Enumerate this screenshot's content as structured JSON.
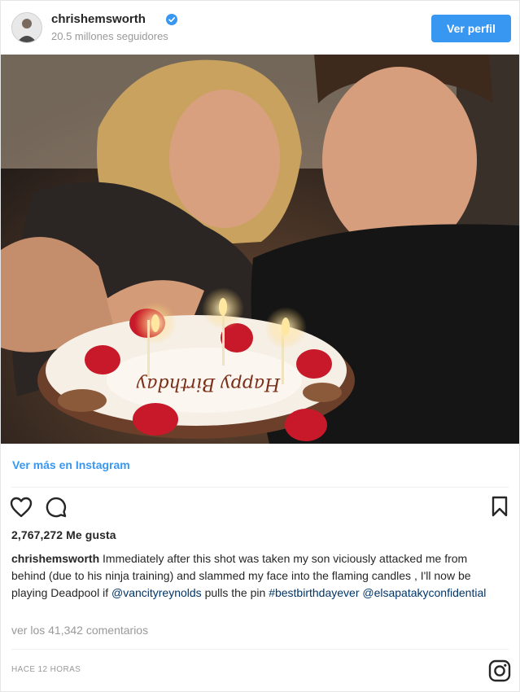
{
  "header": {
    "username": "chrishemsworth",
    "followers": "20.5 millones seguidores",
    "view_profile_label": "Ver perfil",
    "accent_color": "#3897f0"
  },
  "photo": {
    "cake_inscription": "Happy Birthday"
  },
  "links": {
    "view_more": "Ver más en Instagram"
  },
  "actions": {
    "like_icon": "heart-icon",
    "comment_icon": "comment-icon",
    "save_icon": "bookmark-icon"
  },
  "likes": "2,767,272 Me gusta",
  "caption": {
    "author": "chrishemsworth",
    "text_part1": " Immediately after this shot was taken my son viciously attacked me from behind (due to his ninja training) and slammed my face into the flaming candles , I'll now be playing Deadpool if ",
    "mention1": "@vancityreynolds",
    "text_part2": " pulls the pin ",
    "hashtag": "#bestbirthdayever",
    "mention2": "@elsapatakyconfidential"
  },
  "comments_link": "ver los 41,342 comentarios",
  "timestamp": "HACE 12 HORAS",
  "footer_icon": "instagram-logo-icon"
}
